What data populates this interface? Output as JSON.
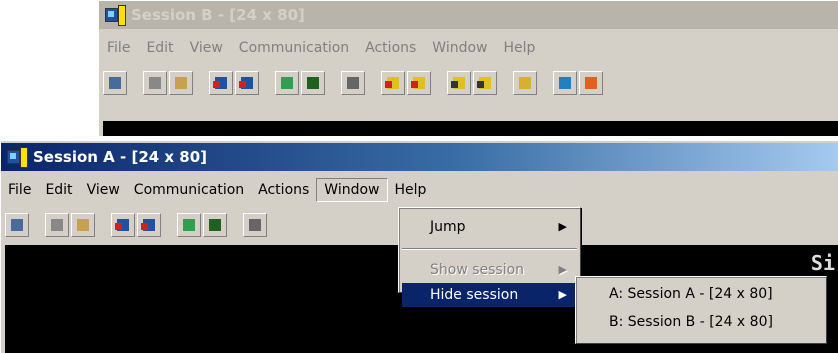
{
  "window_b": {
    "title": "Session B - [24 x 80]",
    "menu": [
      "File",
      "Edit",
      "View",
      "Communication",
      "Actions",
      "Window",
      "Help"
    ],
    "toolbar_icons": [
      "display-icon",
      "copy-icon",
      "paste-icon",
      "send-file-icon",
      "receive-file-icon",
      "keypad-icon",
      "keyboard-map-icon",
      "macro-icon",
      "record-macro-icon",
      "stop-macro-icon",
      "play-macro-icon",
      "macro-list-icon",
      "clipboard-icon",
      "web-icon",
      "help-icon"
    ]
  },
  "window_a": {
    "title": "Session A - [24 x 80]",
    "menu": [
      "File",
      "Edit",
      "View",
      "Communication",
      "Actions",
      "Window",
      "Help"
    ],
    "screen_text": "Si",
    "toolbar_icons": [
      "display-icon",
      "copy-icon",
      "paste-icon",
      "send-file-icon",
      "receive-file-icon",
      "keypad-icon",
      "keyboard-map-icon",
      "macro-icon",
      "stop-macro-icon",
      "clipboard-icon",
      "web-icon",
      "help-icon"
    ]
  },
  "window_menu": {
    "items": [
      {
        "label": "Jump",
        "state": "normal"
      },
      {
        "label": "Show session",
        "state": "disabled"
      },
      {
        "label": "Hide session",
        "state": "highlighted"
      }
    ],
    "submenu_arrow": "▶"
  },
  "session_submenu": {
    "items": [
      "A: Session A - [24 x 80]",
      "B: Session B - [24 x 80]"
    ]
  },
  "colors": {
    "active_title_start": "#0a246a",
    "active_title_end": "#a6caf0",
    "inactive_title": "#b8b4ac",
    "face": "#d4d0c8",
    "highlight": "#0a246a"
  }
}
